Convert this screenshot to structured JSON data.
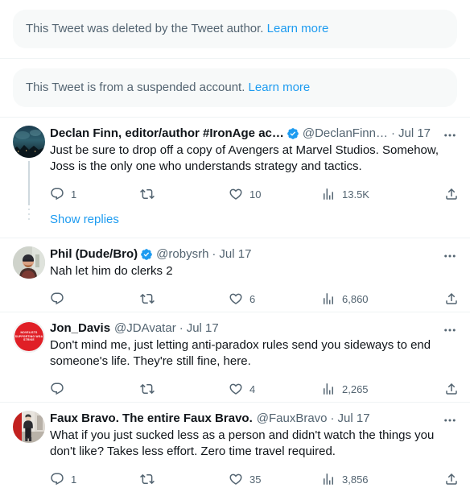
{
  "colors": {
    "link": "#1d9bf0",
    "verified": "#1d9bf0",
    "muted": "#536471",
    "text": "#0f1419",
    "card_bg": "#f7f9f9",
    "border": "#eff3f4",
    "thread_line": "#cfd9de"
  },
  "notices": [
    {
      "message": "This Tweet was deleted by the Tweet author.",
      "link_label": "Learn more"
    },
    {
      "message": "This Tweet is from a suspended account.",
      "link_label": "Learn more"
    }
  ],
  "show_replies_label": "Show replies",
  "action_labels": {
    "reply": "Reply",
    "retweet": "Retweet",
    "like": "Like",
    "views": "Views",
    "share": "Share",
    "more": "More"
  },
  "tweets": [
    {
      "name": "Declan Finn, editor/author #IronAge ac…",
      "verified": true,
      "handle": "@DeclanFinn…",
      "separator": "·",
      "date": "Jul 17",
      "text": "Just be sure to drop off a copy of Avengers at Marvel Studios. Somehow, Joss is the only one who understands strategy and tactics.",
      "replies": "1",
      "retweets": "",
      "likes": "10",
      "views": "13.5K",
      "avatar": "night-sky-city"
    },
    {
      "name": "Phil (Dude/Bro)",
      "verified": true,
      "handle": "@robysrh",
      "separator": "·",
      "date": "Jul 17",
      "text": "Nah let him do clerks 2",
      "replies": "",
      "retweets": "",
      "likes": "6",
      "views": "6,860",
      "avatar": "man-with-cap"
    },
    {
      "name": "Jon_Davis",
      "verified": false,
      "handle": "@JDAvatar",
      "separator": "·",
      "date": "Jul 17",
      "text": "Don't mind me, just letting anti-paradox rules send you sideways to end someone's life. They're still fine, here.",
      "replies": "",
      "retweets": "",
      "likes": "4",
      "views": "2,265",
      "avatar": "red-wga-badge",
      "avatar_text": "NOVELISTS SUPPORTING WGA STRIKE"
    },
    {
      "name": "Faux Bravo. The entire Faux Bravo.",
      "verified": false,
      "handle": "@FauxBravo",
      "separator": "·",
      "date": "Jul 17",
      "text": "What if you just sucked less as a person and didn't watch the things you don't like? Takes less effort. Zero time travel required.",
      "replies": "1",
      "retweets": "",
      "likes": "35",
      "views": "3,856",
      "avatar": "person-standing"
    }
  ]
}
